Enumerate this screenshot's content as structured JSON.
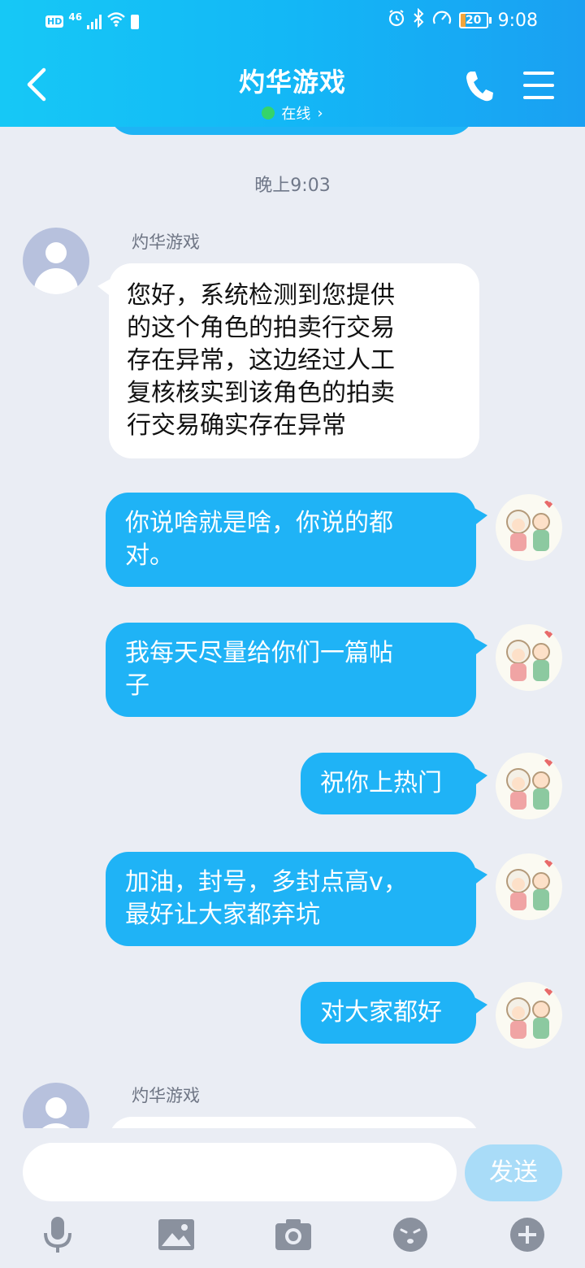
{
  "status_bar": {
    "hd": "HD",
    "network": "46",
    "battery": "20",
    "time": "9:08"
  },
  "header": {
    "title": "灼华游戏",
    "presence": "在线",
    "presence_arrow": "›",
    "back_icon": "chevron-left-icon",
    "phone_icon": "phone-icon",
    "menu_icon": "menu-icon",
    "accent_color": "#13b7f6"
  },
  "chat": {
    "timestamp": "晚上9:03",
    "messages": [
      {
        "from": "other",
        "sender": "灼华游戏",
        "lines": [
          "您好，系统检测到您提供",
          "的这个角色的拍卖行交易",
          "存在异常，这边经过人工",
          "复核核实到该角色的拍卖",
          "行交易确实存在异常"
        ]
      },
      {
        "from": "me",
        "lines": [
          "你说啥就是啥，你说的都",
          "对。"
        ]
      },
      {
        "from": "me",
        "lines": [
          "我每天尽量给你们一篇帖",
          "子"
        ]
      },
      {
        "from": "me",
        "lines": [
          "祝你上热门"
        ]
      },
      {
        "from": "me",
        "lines": [
          "加油，封号，多封点高v，",
          "最好让大家都弃坑"
        ]
      },
      {
        "from": "me",
        "lines": [
          "对大家都好"
        ]
      },
      {
        "from": "other",
        "sender": "灼华游戏",
        "lines": []
      }
    ]
  },
  "input": {
    "value": "",
    "placeholder": "",
    "send_label": "发送"
  },
  "toolbar": [
    "mic-icon",
    "image-icon",
    "camera-icon",
    "emoji-icon",
    "plus-icon"
  ]
}
